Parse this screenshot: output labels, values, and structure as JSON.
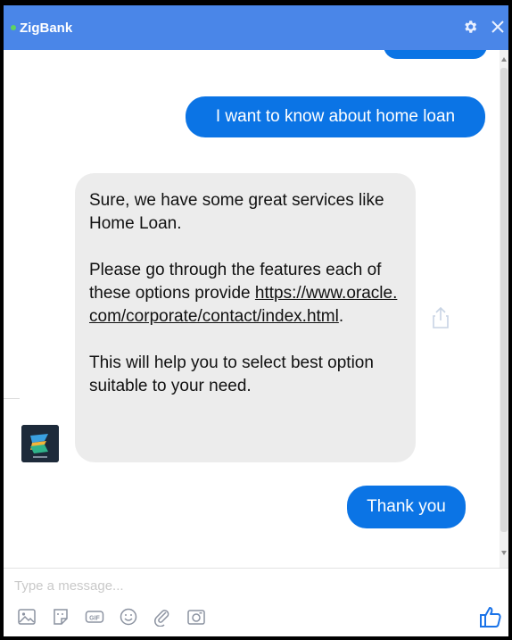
{
  "header": {
    "title": "ZigBank",
    "status": "online",
    "icons": [
      "gear-icon",
      "close-icon"
    ],
    "accent_color": "#4a86e8"
  },
  "conversation": {
    "messages": [
      {
        "sender": "user",
        "text": "I want to know about home loan"
      },
      {
        "sender": "bot",
        "paragraph1": "Sure, we have some great services like Home Loan.",
        "paragraph2_prefix": "Please go through the features each of these options provide ",
        "link": "https://www.oracle.com/corporate/contact/index.html",
        "paragraph2_suffix": ".",
        "paragraph3": "This will help you to select best option suitable to your need."
      },
      {
        "sender": "user",
        "text": "Thank you"
      }
    ],
    "user_bubble_color": "#0b74e5",
    "bot_bubble_color": "#ececec"
  },
  "composer": {
    "placeholder": "Type a message...",
    "tools": [
      "image-icon",
      "sticker-icon",
      "gif-icon",
      "emoji-icon",
      "attachment-icon",
      "camera-icon"
    ],
    "like_icon": "thumbs-up-icon"
  }
}
